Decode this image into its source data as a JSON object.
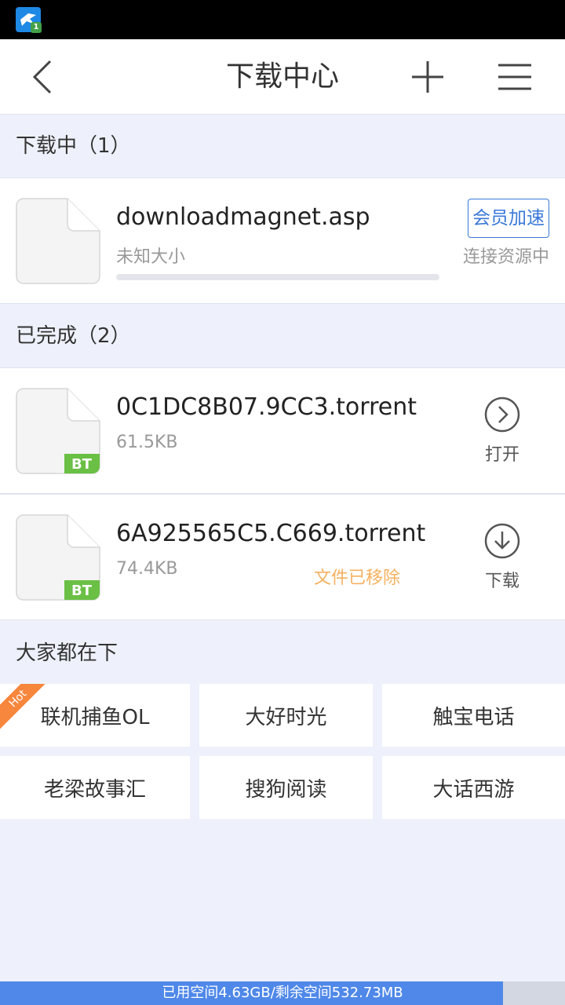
{
  "header": {
    "title": "下载中心"
  },
  "downloading": {
    "heading": "下载中心",
    "section_label": "下载中（1）",
    "items": [
      {
        "name": "downloadmagnet.asp",
        "size": "未知大小",
        "vip_label": "会员加速",
        "status": "连接资源中",
        "progress": 0
      }
    ]
  },
  "completed": {
    "section_label": "已完成（2）",
    "items": [
      {
        "name": "0C1DC8B07.9CC3.torrent",
        "size": "61.5KB",
        "badge": "BT",
        "action_label": "打开",
        "action_icon": "chevron-right-circle-icon"
      },
      {
        "name": "6A925565C5.C669.torrent",
        "size": "74.4KB",
        "badge": "BT",
        "note": "文件已移除",
        "action_label": "下载",
        "action_icon": "download-circle-icon"
      }
    ]
  },
  "popular": {
    "heading": "大家都在下",
    "hot_label": "Hot",
    "items": [
      "联机捕鱼OL",
      "大好时光",
      "触宝电话",
      "老梁故事汇",
      "搜狗阅读",
      "大话西游"
    ]
  },
  "storage": {
    "text": "已用空间4.63GB/剩余空间532.73MB",
    "used_fraction": 0.89
  },
  "colors": {
    "accent": "#3a78d8",
    "bt_badge": "#6abf45",
    "removed_note": "#f4b160",
    "hot_ribbon": "#f7873d"
  }
}
